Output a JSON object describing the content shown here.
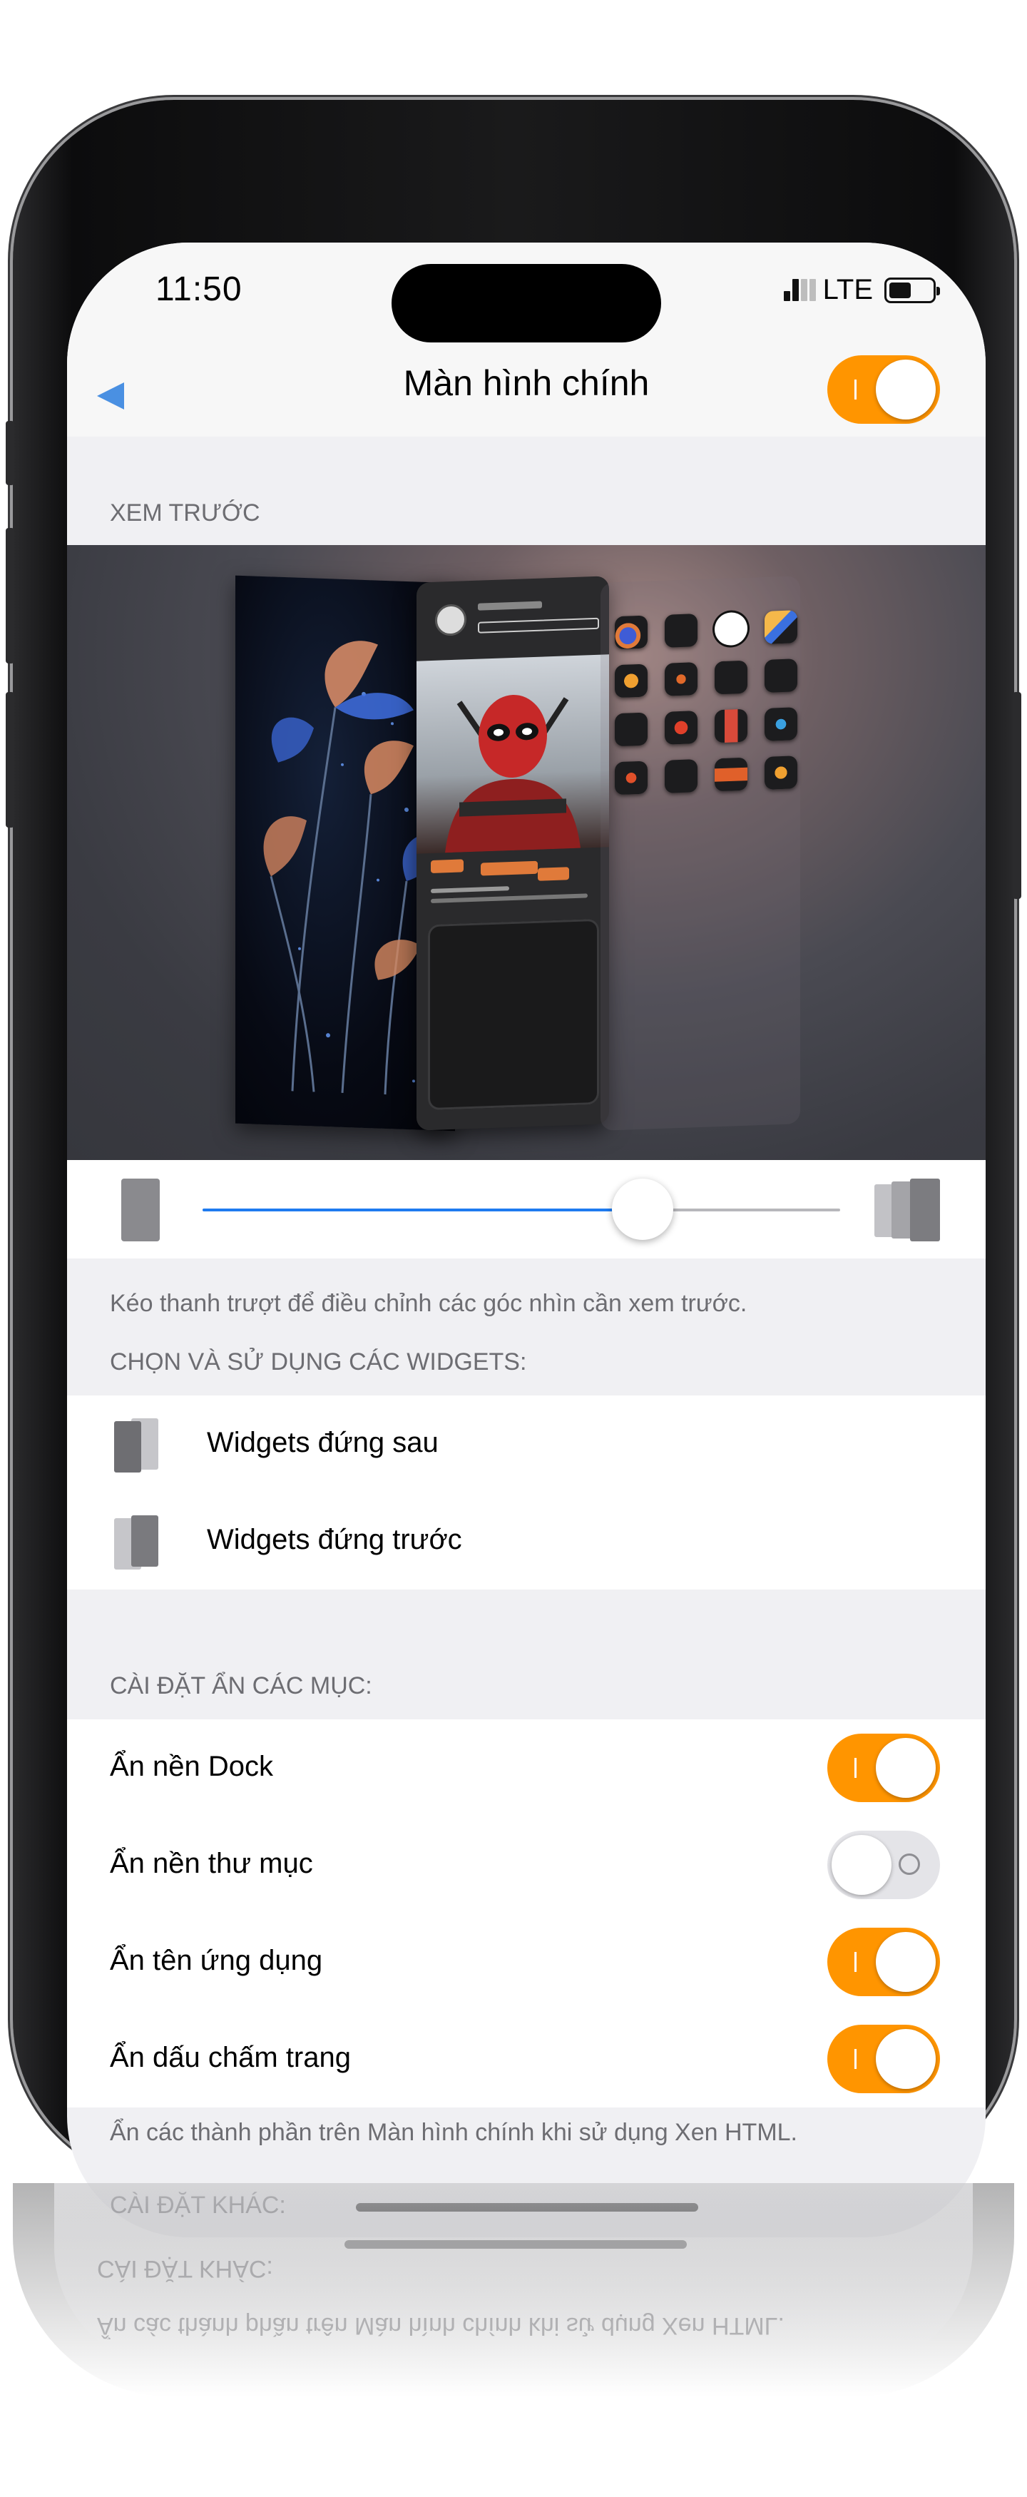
{
  "status_bar": {
    "time": "11:50",
    "network": "LTE"
  },
  "nav": {
    "title": "Màn hình chính",
    "main_toggle_on": true,
    "accent_color": "#ff9500"
  },
  "preview_section": {
    "label": "XEM TRƯỚC"
  },
  "slider": {
    "value": 0.69,
    "fill_color": "#1e7bf0",
    "hint": "Kéo thanh trượt để điều chỉnh các góc nhìn cần xem trước."
  },
  "widgets_section": {
    "label": "CHỌN VÀ SỬ DỤNG CÁC WIDGETS:",
    "items": [
      {
        "label": "Widgets đứng sau",
        "icon": "widget-back-icon"
      },
      {
        "label": "Widgets đứng trước",
        "icon": "widget-front-icon"
      }
    ]
  },
  "hide_section": {
    "label": "CÀI ĐẶT ẨN CÁC MỤC:",
    "items": [
      {
        "label": "Ẩn nền Dock",
        "on": true
      },
      {
        "label": "Ẩn nền thư mục",
        "on": false
      },
      {
        "label": "Ẩn tên ứng dụng",
        "on": true
      },
      {
        "label": "Ẩn dấu chấm trang",
        "on": true
      }
    ],
    "footnote": "Ẩn các thành phần trên Màn hình chính khi sử dụng Xen HTML."
  },
  "other_section": {
    "label": "CÀI ĐẶT KHÁC:"
  }
}
